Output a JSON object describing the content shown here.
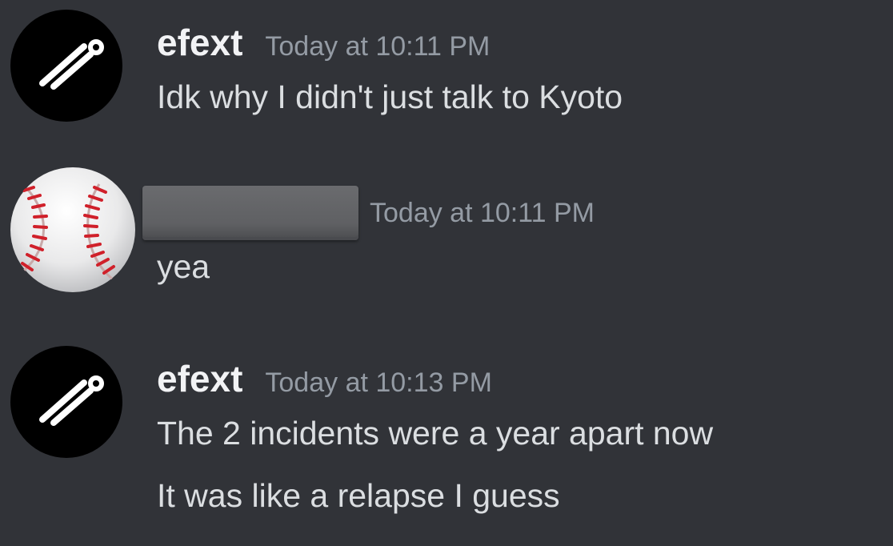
{
  "messages": [
    {
      "author": "efext",
      "timestamp": "Today at 10:11 PM",
      "avatar_icon": "efext-logo-icon",
      "lines": [
        "Idk why I didn't just talk to Kyoto"
      ]
    },
    {
      "author": "",
      "author_redacted": true,
      "timestamp": "Today at 10:11 PM",
      "avatar_icon": "baseball-icon",
      "lines": [
        "yea"
      ]
    },
    {
      "author": "efext",
      "timestamp": "Today at 10:13 PM",
      "avatar_icon": "efext-logo-icon",
      "lines": [
        "The 2 incidents were a year apart now",
        "It was like a relapse I guess"
      ]
    }
  ],
  "colors": {
    "background": "#313338",
    "username": "#f2f3f5",
    "timestamp": "#949ba4",
    "message_text": "#dbdee1",
    "redaction": "#5f6063"
  }
}
